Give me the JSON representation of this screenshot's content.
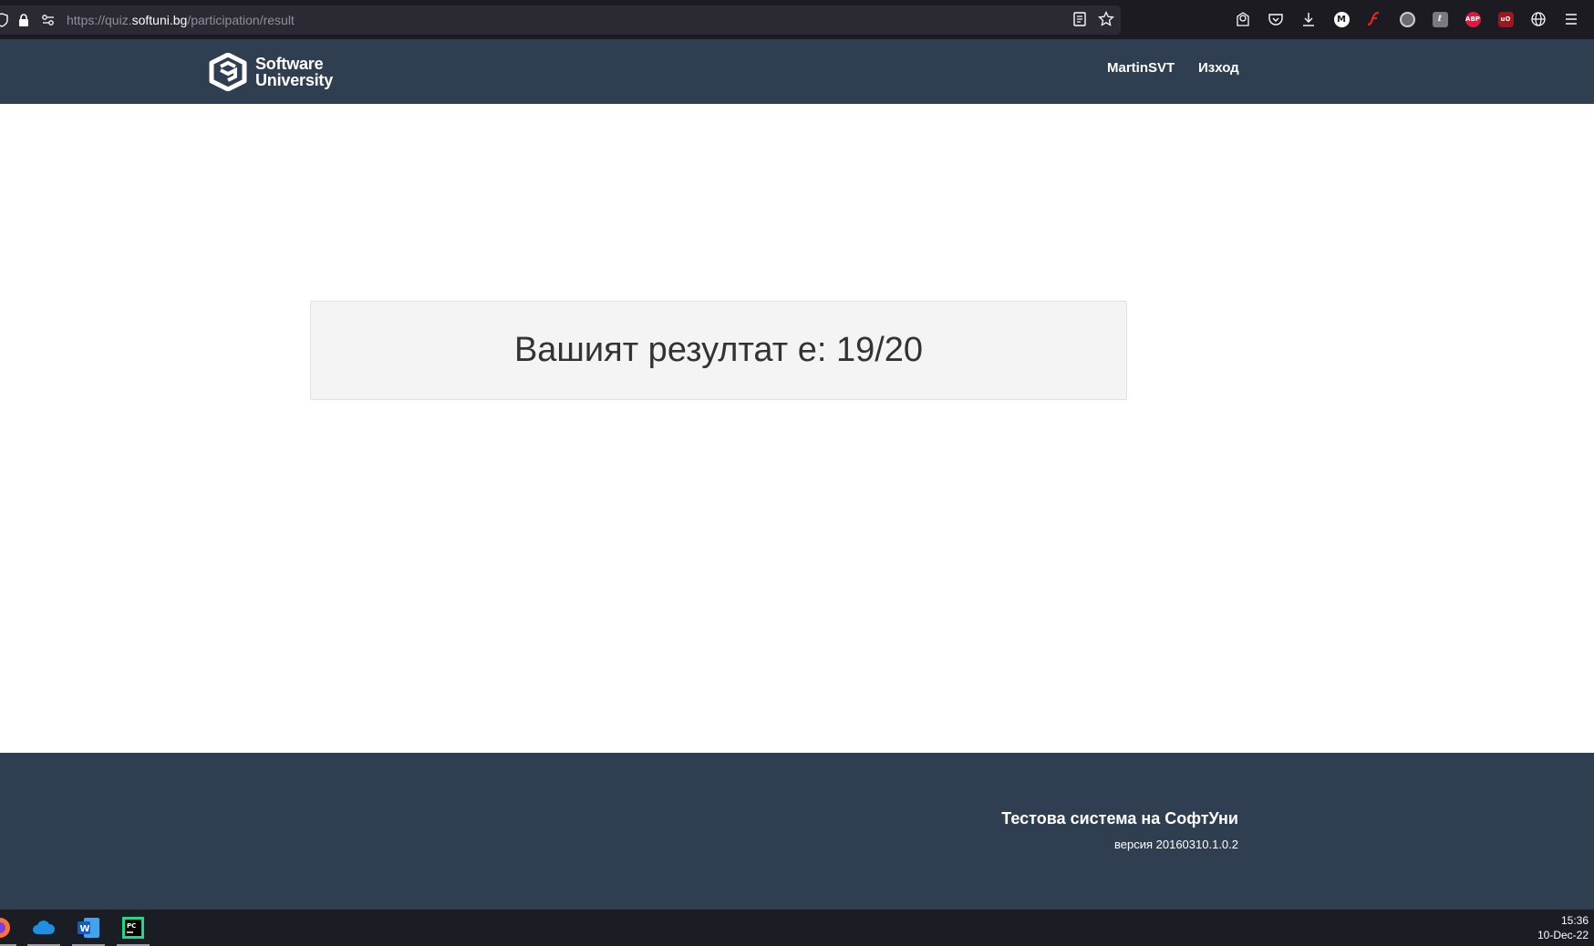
{
  "browser": {
    "url_prefix": "https://quiz.",
    "url_host": "softuni.bg",
    "url_path": "/participation/result"
  },
  "header": {
    "logo_line1": "Software",
    "logo_line2": "University",
    "nav": {
      "user": "MartinSVT",
      "logout": "Изход"
    }
  },
  "main": {
    "result_text": "Вашият резултат е: 19/20"
  },
  "footer": {
    "title": "Тестова система на СофтУни",
    "version": "версия 20160310.1.0.2"
  },
  "taskbar": {
    "time": "15:36",
    "date": "10-Dec-22"
  },
  "toolbar_icons": [
    "reader-view-icon",
    "bookmark-star-icon",
    "account-icon",
    "pocket-icon",
    "download-icon",
    "m-extension-icon",
    "flash-icon",
    "circle-extension-icon",
    "scroll-extension-icon",
    "adblock-plus-icon",
    "ublock-icon",
    "globe-icon",
    "menu-icon"
  ],
  "colors": {
    "header_bg": "#2f3e51",
    "footer_bg": "#2f3e51",
    "result_box_bg": "#f4f4f4"
  }
}
